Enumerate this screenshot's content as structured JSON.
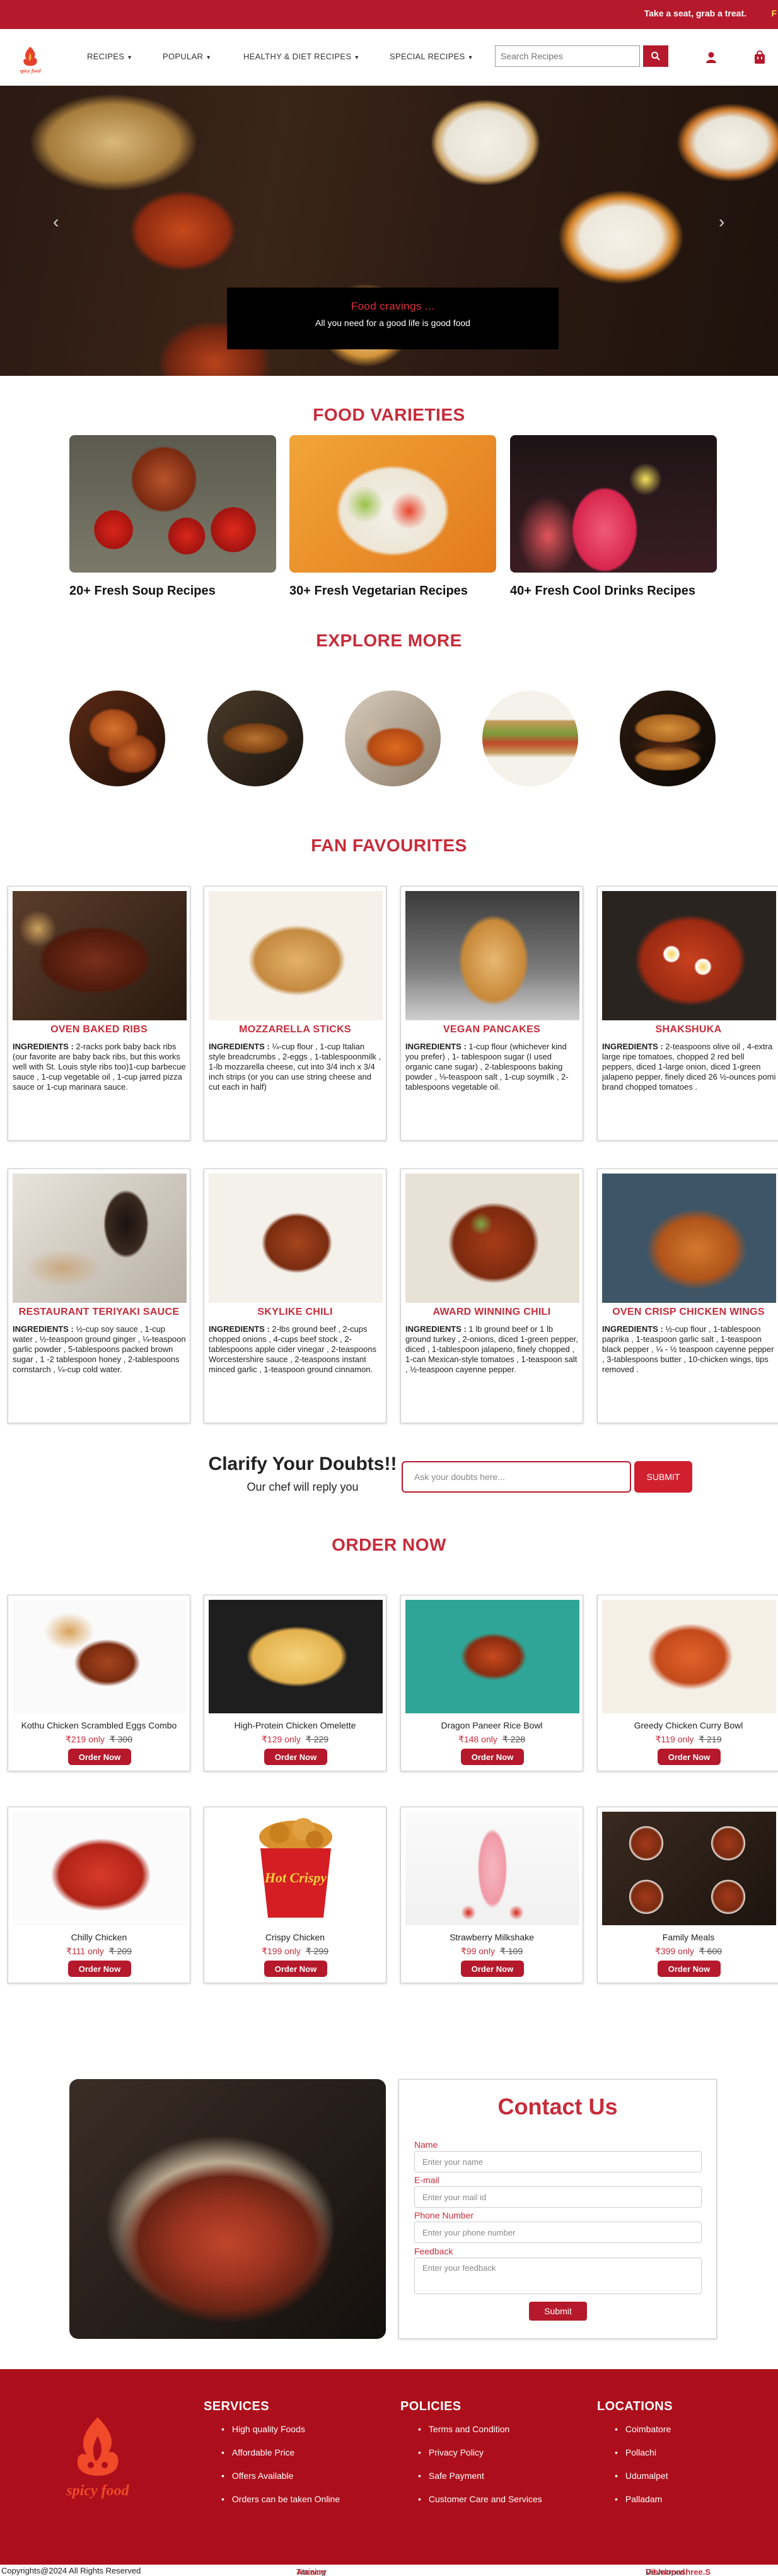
{
  "topbar": {
    "message": "Take a seat, grab a treat."
  },
  "brand": {
    "name": "spicy food"
  },
  "nav": {
    "menus": [
      "RECIPES",
      "POPULAR",
      "HEALTHY & DIET RECIPES",
      "SPECIAL RECIPES"
    ],
    "search_placeholder": "Search Recipes"
  },
  "hero": {
    "title": "Food cravings ...",
    "subtitle": "All you need for a good life is good food"
  },
  "varieties": {
    "title": "FOOD VARIETIES",
    "items": [
      "20+ Fresh Soup Recipes",
      "30+ Fresh Vegetarian Recipes",
      "40+ Fresh Cool Drinks Recipes"
    ]
  },
  "explore": {
    "title": "EXPLORE MORE"
  },
  "fans": {
    "title": "FAN FAVOURITES",
    "label": "INGREDIENTS : ",
    "items": [
      {
        "title": "OVEN BAKED RIBS",
        "desc": "2-racks pork baby back ribs (our favorite are baby back ribs, but this works well with St. Louis style ribs too)1-cup barbecue sauce , 1-cup vegetable oil , 1-cup jarred pizza sauce or 1-cup marinara sauce."
      },
      {
        "title": "MOZZARELLA STICKS",
        "desc": "¼-cup flour , 1-cup Italian style breadcrumbs , 2-eggs , 1-tablespoonmilk , 1-lb mozzarella cheese, cut into 3/4 inch x 3/4 inch strips (or you can use string cheese and cut each in half)"
      },
      {
        "title": "VEGAN PANCAKES",
        "desc": "1-cup flour (whichever kind you prefer) , 1- tablespoon sugar (I used organic cane sugar) , 2-tablespoons baking powder , ⅛-teaspoon salt , 1-cup soymilk , 2-tablespoons vegetable oil."
      },
      {
        "title": "SHAKSHUKA",
        "desc": "2-teaspoons olive oil , 4-extra large ripe tomatoes, chopped 2 red bell peppers, diced 1-large onion, diced 1-green jalapeno pepper, finely diced 26 ½-ounces pomi brand chopped tomatoes ."
      },
      {
        "title": "RESTAURANT TERIYAKI SAUCE",
        "desc": "½-cup soy sauce , 1-cup water , ½-teaspoon ground ginger , ¼-teaspoon garlic powder , 5-tablespoons packed brown sugar , 1 -2 tablespoon honey , 2-tablespoons cornstarch , ¼-cup cold water."
      },
      {
        "title": "SKYLIKE CHILI",
        "desc": "2-lbs ground beef , 2-cups chopped onions , 4-cups beef stock , 2-tablespoons apple cider vinegar , 2-teaspoons Worcestershire sauce , 2-teaspoons instant minced garlic , 1-teaspoon ground cinnamon."
      },
      {
        "title": "AWARD WINNING CHILI",
        "desc": "1 lb ground beef or 1 lb ground turkey , 2-onions, diced 1-green pepper, diced , 1-tablespoon jalapeno, finely chopped , 1-can Mexican-style tomatoes , 1-teaspoon salt , ½-teaspoon cayenne pepper."
      },
      {
        "title": "OVEN CRISP CHICKEN WINGS",
        "desc": "½-cup flour , 1-tablespoon paprika , 1-teaspoon garlic salt , 1-teaspoon black pepper , ¼ - ½ teaspoon cayenne pepper , 3-tablespoons butter , 10-chicken wings, tips removed ."
      }
    ]
  },
  "doubts": {
    "title": "Clarify Your Doubts!!",
    "subtitle": "Our chef will reply you",
    "placeholder": "Ask your doubts here...",
    "button": "SUBMIT"
  },
  "order": {
    "title": "ORDER NOW",
    "button": "Order Now",
    "items": [
      {
        "name": "Kothu Chicken Scrambled Eggs Combo",
        "price": "₹219 only",
        "old": "₹ 300"
      },
      {
        "name": "High-Protein Chicken Omelette",
        "price": "₹129 only",
        "old": "₹ 229"
      },
      {
        "name": "Dragon Paneer Rice Bowl",
        "price": "₹148 only",
        "old": "₹ 228"
      },
      {
        "name": "Greedy Chicken Curry Bowl",
        "price": "₹119 only",
        "old": "₹ 219"
      },
      {
        "name": "Chilly Chicken",
        "price": "₹111 only",
        "old": "₹ 209"
      },
      {
        "name": "Crispy Chicken",
        "price": "₹199 only",
        "old": "₹ 299"
      },
      {
        "name": "Strawberry Milkshake",
        "price": "₹99 only",
        "old": "₹ 109"
      },
      {
        "name": "Family Meals",
        "price": "₹399 only",
        "old": "₹ 600"
      }
    ],
    "bucket_text": "Hot Crispy"
  },
  "contact": {
    "title": "Contact Us",
    "fields": [
      {
        "label": "Name",
        "placeholder": "Enter your name"
      },
      {
        "label": "E-mail",
        "placeholder": "Enter your mail id"
      },
      {
        "label": "Phone Number",
        "placeholder": "Enter your phone number"
      },
      {
        "label": "Feedback",
        "placeholder": "Enter your feedback"
      }
    ],
    "submit": "Submit"
  },
  "footer": {
    "services": {
      "title": "SERVICES",
      "items": [
        "High quality Foods",
        "Affordable Price",
        "Offers Available",
        "Orders can be taken Online"
      ]
    },
    "policies": {
      "title": "POLICIES",
      "items": [
        "Terms and Condition",
        "Privacy Policy",
        "Safe Payment",
        "Customer Care and Services"
      ]
    },
    "locations": {
      "title": "LOCATIONS",
      "items": [
        "Coimbatore",
        "Pollachi",
        "Udumalpet",
        "Palladam"
      ]
    },
    "copyright": "Copyrights@2024 All Rights Reserved",
    "training_label": "Training and Mentorship by ",
    "training_name": "Atozarv India Pvt Ltd",
    "dev_label": "Developed by ",
    "dev_name": "Vibhurnashree.S"
  },
  "colors": {
    "brand_red": "#b5192b",
    "title_red": "#c72c3b",
    "footer_red": "#ad0e1b"
  }
}
